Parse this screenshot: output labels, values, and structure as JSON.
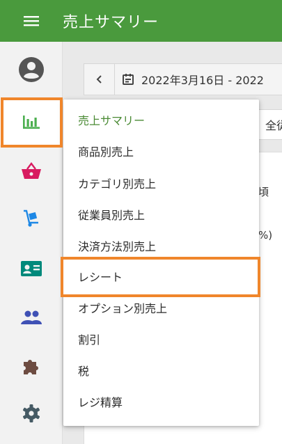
{
  "header": {
    "title": "売上サマリー",
    "background": "#4a9a3d",
    "menu_icon": "hamburger-menu-icon"
  },
  "sidebar": {
    "items": [
      {
        "name": "account",
        "icon": "account-circle-icon",
        "color": "#555555"
      },
      {
        "name": "reports",
        "icon": "bar-chart-icon",
        "color": "#4caf50",
        "active": true
      },
      {
        "name": "items",
        "icon": "shopping-basket-icon",
        "color": "#d81b60"
      },
      {
        "name": "inventory",
        "icon": "hand-truck-icon",
        "color": "#1e88e5"
      },
      {
        "name": "customers",
        "icon": "contact-card-icon",
        "color": "#00897b"
      },
      {
        "name": "employees",
        "icon": "people-icon",
        "color": "#3f51b5"
      },
      {
        "name": "integrations",
        "icon": "puzzle-icon",
        "color": "#6d4c41"
      },
      {
        "name": "settings",
        "icon": "gear-icon",
        "color": "#455a64"
      }
    ]
  },
  "main": {
    "date_range": "2022年3月16日 - 2022",
    "filter_text": "全従",
    "card_label": "頃",
    "card_pct": "%)"
  },
  "reports_menu": {
    "items": [
      {
        "label": "売上サマリー",
        "current": true
      },
      {
        "label": "商品別売上"
      },
      {
        "label": "カテゴリ別売上"
      },
      {
        "label": "従業員別売上"
      },
      {
        "label": "決済方法別売上"
      },
      {
        "label": "レシート",
        "highlighted": true
      },
      {
        "label": "オプション別売上"
      },
      {
        "label": "割引"
      },
      {
        "label": "税"
      },
      {
        "label": "レジ精算"
      }
    ]
  },
  "colors": {
    "accent": "#4a9a3d",
    "highlight": "#f0862b"
  }
}
